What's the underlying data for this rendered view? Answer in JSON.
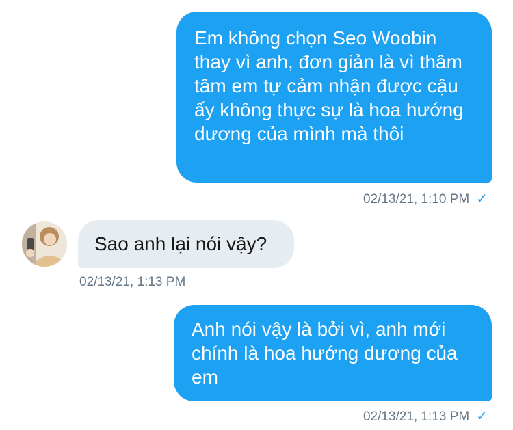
{
  "conversation": {
    "messages": [
      {
        "direction": "sent",
        "text": "Em không chọn Seo Woobin thay vì anh, đơn giản là vì thâm tâm em tự cảm nhận được cậu ấy không thực sự là hoa hướng dương của mình mà thôi",
        "timestamp": "02/13/21, 1:10 PM",
        "status_icon": "checkmark-icon"
      },
      {
        "direction": "received",
        "text": "Sao anh lại nói vậy?",
        "timestamp": "02/13/21, 1:13 PM",
        "avatar_icon": "user-avatar"
      },
      {
        "direction": "sent",
        "text": "Anh nói vậy là bởi vì, anh mới chính là hoa hướng dương của em",
        "timestamp": "02/13/21, 1:13 PM",
        "status_icon": "checkmark-icon"
      }
    ],
    "check_glyph": "✓"
  },
  "colors": {
    "sent_bubble": "#1da1f2",
    "received_bubble": "#e6ecf0",
    "timestamp_text": "#657786"
  }
}
